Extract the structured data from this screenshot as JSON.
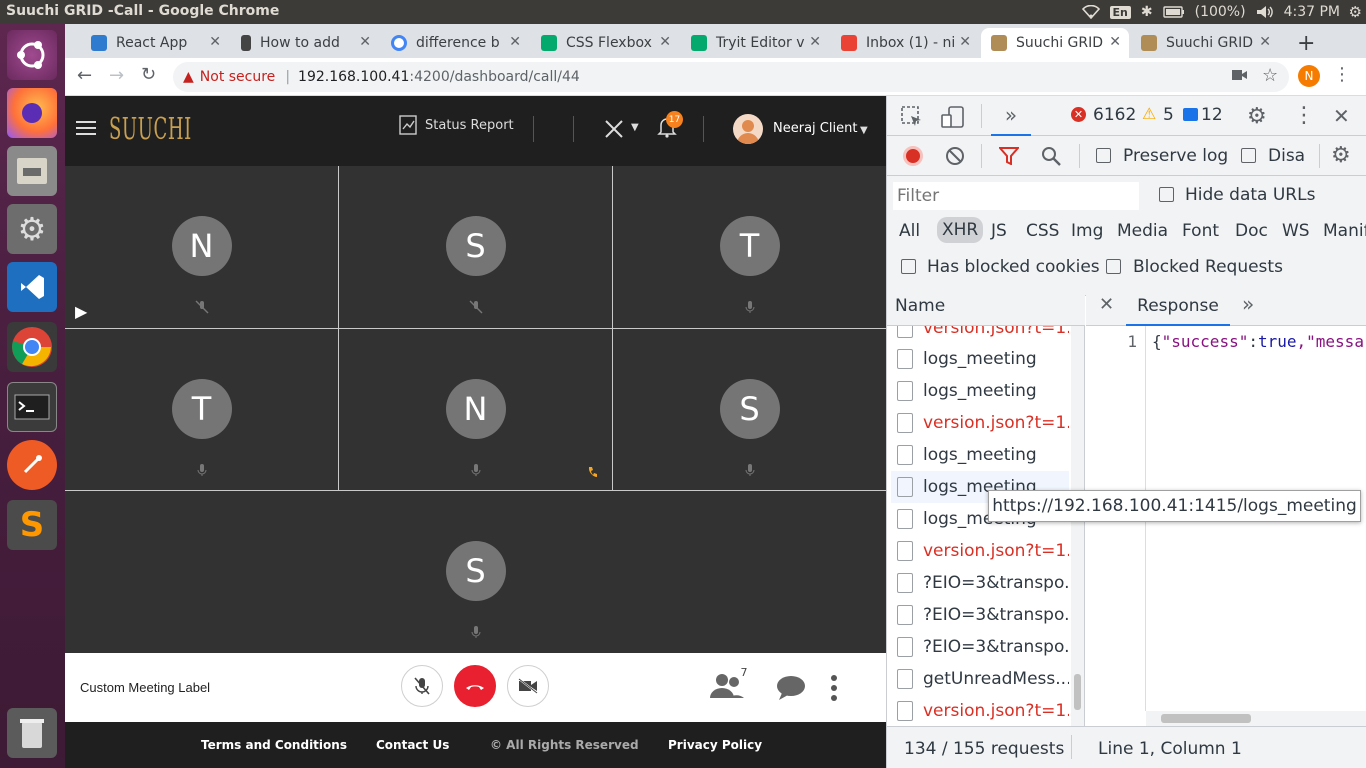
{
  "os": {
    "window_title": "Suuchi GRID -Call - Google Chrome",
    "keyboard": "En",
    "battery": "(100%)",
    "clock": "4:37 PM"
  },
  "browser": {
    "tabs": [
      {
        "label": "React App",
        "icon": "react-icon",
        "color": "#2e7bcf"
      },
      {
        "label": "How to add",
        "icon": "stackoverflow-icon",
        "color": "#444"
      },
      {
        "label": "difference b",
        "icon": "google-icon",
        "color": "#4285f4"
      },
      {
        "label": "CSS Flexbox",
        "icon": "w3schools-icon",
        "color": "#04aa6d"
      },
      {
        "label": "Tryit Editor v",
        "icon": "w3schools-icon",
        "color": "#04aa6d"
      },
      {
        "label": "Inbox (1) - ni",
        "icon": "gmail-icon",
        "color": "#ea4335"
      },
      {
        "label": "Suuchi GRID",
        "icon": "suuchi-icon",
        "color": "#b08d57"
      },
      {
        "label": "Suuchi GRID",
        "icon": "suuchi-icon",
        "color": "#b08d57"
      }
    ],
    "new_tab": "+",
    "security": "Not secure",
    "url_host": "192.168.100.41",
    "url_rest": ":4200/dashboard/call/44",
    "profile_initial": "N"
  },
  "app": {
    "logo": "SUUCHI",
    "status_report": "Status Report",
    "notification_count": "17",
    "user_name": "Neeraj Client",
    "participants": [
      {
        "initial": "N"
      },
      {
        "initial": "S"
      },
      {
        "initial": "T"
      },
      {
        "initial": "T"
      },
      {
        "initial": "N"
      },
      {
        "initial": "S"
      },
      {
        "initial": "S"
      }
    ],
    "meeting_label": "Custom Meeting Label",
    "participant_count": "7",
    "footer": {
      "terms": "Terms and Conditions",
      "contact": "Contact Us",
      "rights": "© All Rights Reserved",
      "privacy": "Privacy Policy"
    }
  },
  "devtools": {
    "errors": "6162",
    "warnings": "5",
    "messages": "12",
    "preserve_log": "Preserve log",
    "disable_cache": "Disa",
    "filter_placeholder": "Filter",
    "hide_data_urls": "Hide data URLs",
    "types": [
      "All",
      "XHR",
      "JS",
      "CSS",
      "Img",
      "Media",
      "Font",
      "Doc",
      "WS",
      "Manif"
    ],
    "active_type": "XHR",
    "has_blocked_cookies": "Has blocked cookies",
    "blocked_requests": "Blocked Requests",
    "name_header": "Name",
    "response_tab": "Response",
    "requests": [
      {
        "name": "version.json?t=1...",
        "error": true
      },
      {
        "name": "logs_meeting",
        "error": false
      },
      {
        "name": "logs_meeting",
        "error": false
      },
      {
        "name": "version.json?t=1...",
        "error": true
      },
      {
        "name": "logs_meeting",
        "error": false
      },
      {
        "name": "logs_meeting",
        "error": false
      },
      {
        "name": "logs_meeting",
        "error": false
      },
      {
        "name": "version.json?t=1...",
        "error": true
      },
      {
        "name": "?EIO=3&transpo...",
        "error": false
      },
      {
        "name": "?EIO=3&transpo...",
        "error": false
      },
      {
        "name": "?EIO=3&transpo...",
        "error": false
      },
      {
        "name": "getUnreadMess...",
        "error": false
      },
      {
        "name": "version.json?t=1...",
        "error": true
      }
    ],
    "line_no": "1",
    "response_key": "\"success\"",
    "response_colon": ":",
    "response_val": "true",
    "response_rest": ",\"messa",
    "tooltip": "https://192.168.100.41:1415/logs_meeting",
    "request_count": "134 / 155 requests",
    "cursor_pos": "Line 1, Column 1"
  }
}
